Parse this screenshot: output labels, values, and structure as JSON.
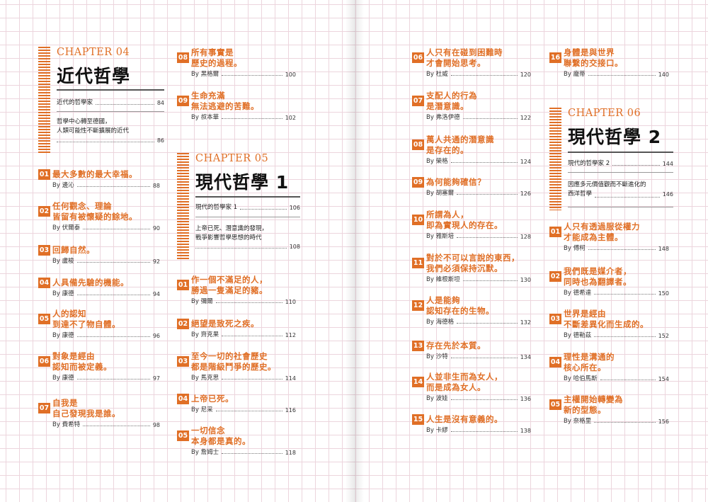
{
  "col1": {
    "chapter": {
      "label": "CHAPTER 04",
      "title": "近代哲學",
      "subs": [
        {
          "lines": [
            "近代的哲學家"
          ],
          "page": "84"
        },
        {
          "lines": [
            "哲學中心轉至德國，",
            "人類可能性不斷擴展的近代"
          ],
          "page": "86"
        }
      ]
    },
    "entries": [
      {
        "num": "01",
        "title": [
          "最大多數的最大幸福。"
        ],
        "by": "By 邊沁",
        "page": "88"
      },
      {
        "num": "02",
        "title": [
          "任何觀念、理論",
          "皆留有被懷疑的餘地。"
        ],
        "by": "By 伏爾泰",
        "page": "90"
      },
      {
        "num": "03",
        "title": [
          "回歸自然。"
        ],
        "by": "By 盧梭",
        "page": "92"
      },
      {
        "num": "04",
        "title": [
          "人具備先驗的機能。"
        ],
        "by": "By 康德",
        "page": "94"
      },
      {
        "num": "05",
        "title": [
          "人的認知",
          "到達不了物自體。"
        ],
        "by": "By 康德",
        "page": "96"
      },
      {
        "num": "06",
        "title": [
          "對象是經由",
          "認知而被定義。"
        ],
        "by": "By 康德",
        "page": "97"
      },
      {
        "num": "07",
        "title": [
          "自我是",
          "自己發現我是誰。"
        ],
        "by": "By 費希特",
        "page": "98"
      }
    ]
  },
  "col2": {
    "entries_top": [
      {
        "num": "08",
        "title": [
          "所有事實是",
          "歷史的過程。"
        ],
        "by": "By 黑格爾",
        "page": "100"
      },
      {
        "num": "09",
        "title": [
          "生命充滿",
          "無法逃避的苦難。"
        ],
        "by": "By 叔本華",
        "page": "102"
      }
    ],
    "chapter": {
      "label": "CHAPTER 05",
      "title": "現代哲學 1",
      "subs": [
        {
          "lines": [
            "現代的哲學家 1"
          ],
          "page": "106"
        },
        {
          "lines": [
            "上帝已死、潛意識的發現，",
            "戰爭影響哲學思想的時代"
          ],
          "page": "108"
        }
      ]
    },
    "entries": [
      {
        "num": "01",
        "title": [
          "作一個不滿足的人，",
          "勝過一隻滿足的豬。"
        ],
        "by": "By 彌爾",
        "page": "110"
      },
      {
        "num": "02",
        "title": [
          "絕望是致死之疾。"
        ],
        "by": "By 齊克果",
        "page": "112"
      },
      {
        "num": "03",
        "title": [
          "至今一切的社會歷史",
          "都是階級鬥爭的歷史。"
        ],
        "by": "By 馬克思",
        "page": "114"
      },
      {
        "num": "04",
        "title": [
          "上帝已死。"
        ],
        "by": "By 尼采",
        "page": "116"
      },
      {
        "num": "05",
        "title": [
          "一切信念",
          "本身都是真的。"
        ],
        "by": "By 詹姆士",
        "page": "118"
      }
    ]
  },
  "col3": {
    "entries": [
      {
        "num": "06",
        "title": [
          "人只有在碰到困難時",
          "才會開始思考。"
        ],
        "by": "By 杜威",
        "page": "120"
      },
      {
        "num": "07",
        "title": [
          "支配人的行為",
          "是潛意識。"
        ],
        "by": "By 弗洛伊德",
        "page": "122"
      },
      {
        "num": "08",
        "title": [
          "萬人共通的潛意識",
          "是存在的。"
        ],
        "by": "By 榮格",
        "page": "124"
      },
      {
        "num": "09",
        "title": [
          "為何能夠確信？"
        ],
        "by": "By 胡塞爾",
        "page": "126"
      },
      {
        "num": "10",
        "title": [
          "所謂為人，",
          "即為實現人的存在。"
        ],
        "by": "By 雅斯培",
        "page": "128"
      },
      {
        "num": "11",
        "title": [
          "對於不可以言說的東西，",
          "我們必須保持沉默。"
        ],
        "by": "By 維根斯坦",
        "page": "130"
      },
      {
        "num": "12",
        "title": [
          "人是能夠",
          "認知存在的生物。"
        ],
        "by": "By 海德格",
        "page": "132"
      },
      {
        "num": "13",
        "title": [
          "存在先於本質。"
        ],
        "by": "By 沙特",
        "page": "134"
      },
      {
        "num": "14",
        "title": [
          "人並非生而為女人，",
          "而是成為女人。"
        ],
        "by": "By 波娃",
        "page": "136"
      },
      {
        "num": "15",
        "title": [
          "人生是沒有意義的。"
        ],
        "by": "By 卡繆",
        "page": "138"
      }
    ]
  },
  "col4": {
    "entries_top": [
      {
        "num": "16",
        "title": [
          "身體是與世界",
          "聯繫的交接口。"
        ],
        "by": "By 龐蒂",
        "page": "140"
      }
    ],
    "chapter": {
      "label": "CHAPTER 06",
      "title": "現代哲學 2",
      "subs": [
        {
          "lines": [
            "現代的哲學家 2"
          ],
          "page": "144"
        },
        {
          "lines": [
            "因應多元價值觀而不斷進化的",
            "西洋哲學"
          ],
          "page": "146"
        }
      ]
    },
    "entries": [
      {
        "num": "01",
        "title": [
          "人只有透過服從權力",
          "才能成為主體。"
        ],
        "by": "By 傅柯",
        "page": "148"
      },
      {
        "num": "02",
        "title": [
          "我們既是媒介者，",
          "同時也為翻譯者。"
        ],
        "by": "By 德希達",
        "page": "150"
      },
      {
        "num": "03",
        "title": [
          "世界是經由",
          "不斷差異化而生成的。"
        ],
        "by": "By 德勒茲",
        "page": "152"
      },
      {
        "num": "04",
        "title": [
          "理性是溝通的",
          "核心所在。"
        ],
        "by": "By 哈伯馬斯",
        "page": "154"
      },
      {
        "num": "05",
        "title": [
          "主權開始轉變為",
          "新的型態。"
        ],
        "by": "By 奈格里",
        "page": "156"
      }
    ]
  }
}
